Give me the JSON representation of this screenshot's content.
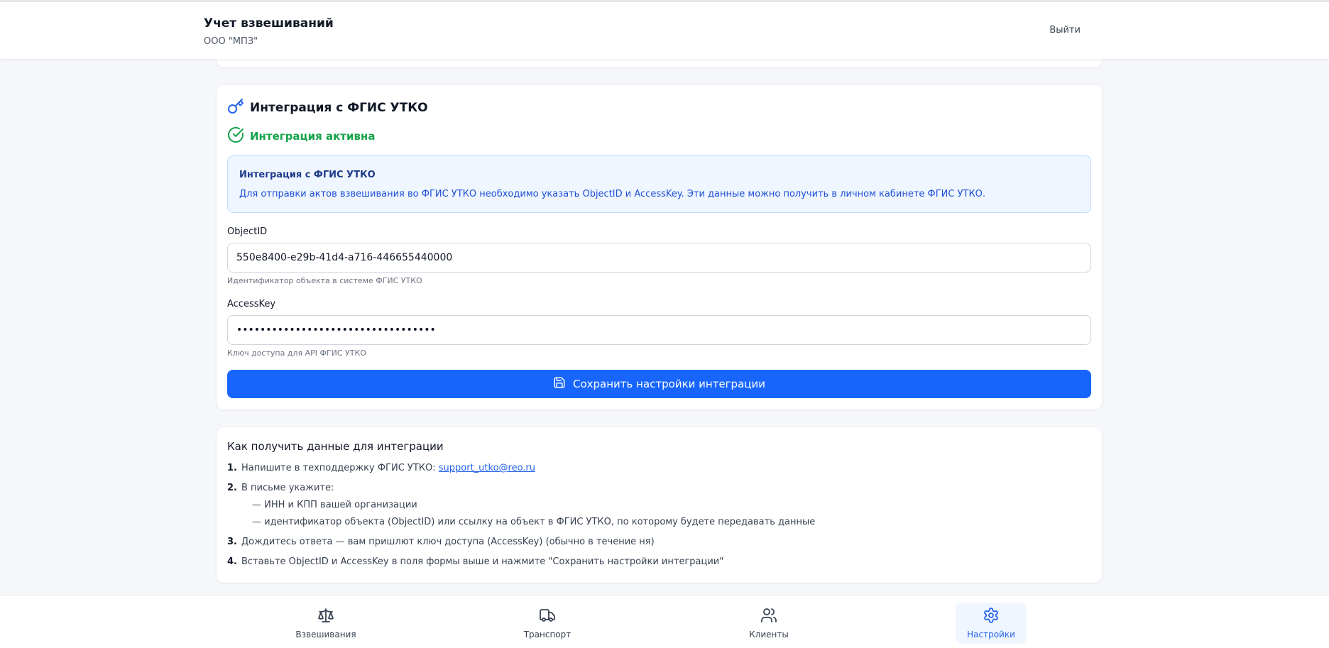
{
  "header": {
    "title": "Учет взвешиваний",
    "subtitle": "ООО \"МПЗ\"",
    "logout_label": "Выйти"
  },
  "integration": {
    "title": "Интеграция с ФГИС УТКО",
    "status_text": "Интеграция активна",
    "info_title": "Интеграция с ФГИС УТКО",
    "info_text": "Для отправки актов взвешивания во ФГИС УТКО необходимо указать ObjectID и AccessKey. Эти данные можно получить в личном кабинете ФГИС УТКО.",
    "object_id_label": "ObjectID",
    "object_id_value": "550e8400-e29b-41d4-a716-446655440000",
    "object_id_hint": "Идентификатор объекта в системе ФГИС УТКО",
    "access_key_label": "AccessKey",
    "access_key_value": "**********************************",
    "access_key_hint": "Ключ доступа для API ФГИС УТКО",
    "save_label": "Сохранить настройки интеграции"
  },
  "howto": {
    "title": "Как получить данные для интеграции",
    "step1_num": "1.",
    "step1_text": "Напишите в техподдержку ФГИС УТКО: ",
    "step1_link": "support_utko@reo.ru",
    "step2_num": "2.",
    "step2_text": "В письме укажите:",
    "step2_sub1": "— ИНН и КПП вашей организации",
    "step2_sub2": "— идентификатор объекта (ObjectID) или ссылку на объект в ФГИС УТКО, по которому будете передавать данные",
    "step3_num": "3.",
    "step3_text": "Дождитесь ответа — вам пришлют ключ доступа (AccessKey) (обычно в течение ня)",
    "step4_num": "4.",
    "step4_text": "Вставьте ObjectID и AccessKey в поля формы выше и нажмите \"Сохранить настройки интеграции\""
  },
  "nav": {
    "items": [
      {
        "label": "Взвешивания",
        "icon": "scale-icon"
      },
      {
        "label": "Транспорт",
        "icon": "truck-icon"
      },
      {
        "label": "Клиенты",
        "icon": "users-icon"
      },
      {
        "label": "Настройки",
        "icon": "gear-icon",
        "active": true
      }
    ]
  },
  "colors": {
    "primary": "#1765fd",
    "success": "#16a34a",
    "info_bg": "#eff6ff",
    "info_border": "#bfdbfe"
  }
}
